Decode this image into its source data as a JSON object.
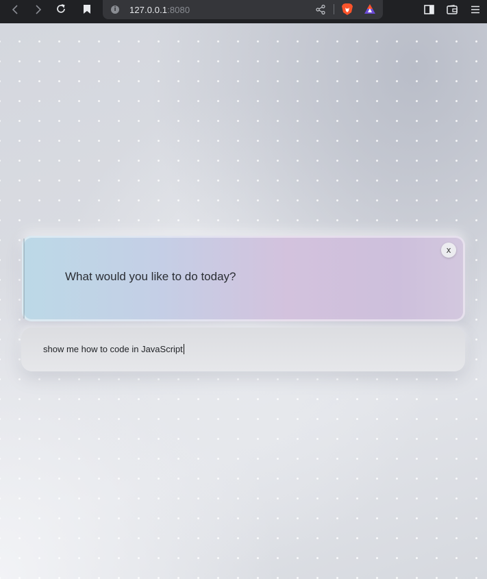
{
  "browser": {
    "url_host": "127.0.0.1",
    "url_port": ":8080",
    "nav_icons": [
      "back-icon",
      "forward-icon",
      "reload-icon",
      "bookmark-icon"
    ],
    "url_icons": [
      "info-icon",
      "share-icon",
      "brave-shields-icon",
      "brave-rewards-icon"
    ],
    "tool_icons": [
      "sidebar-icon",
      "wallet-icon",
      "menu-icon"
    ],
    "info_glyph": "i"
  },
  "main": {
    "prompt": "What would you like to do today?",
    "close_label": "x",
    "input_value": "show me how to code in JavaScript"
  },
  "colors": {
    "toolbar_bg": "#202124",
    "urlbar_bg": "#35363a",
    "brave_orange": "#fb542b",
    "card_gradient_start": "#bcd9e7",
    "card_gradient_end": "#cdbfdc"
  }
}
